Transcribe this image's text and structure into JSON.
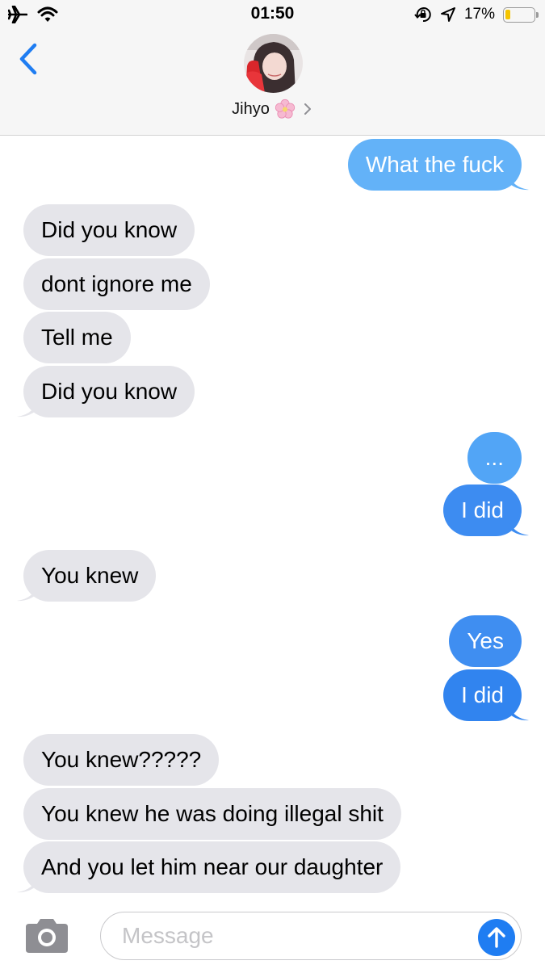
{
  "status_bar": {
    "time": "01:50",
    "battery_percent": "17%",
    "battery_level": 0.17,
    "icons": [
      "airplane-icon",
      "wifi-icon",
      "rotation-lock-icon",
      "location-icon",
      "battery-icon"
    ]
  },
  "header": {
    "contact_name": "Jihyo",
    "contact_emoji": "cherry-blossom-icon"
  },
  "messages": [
    {
      "sender": "me",
      "text": "What the fuck"
    },
    {
      "sender": "them",
      "text": "Did you know"
    },
    {
      "sender": "them",
      "text": "dont ignore me"
    },
    {
      "sender": "them",
      "text": "Tell me"
    },
    {
      "sender": "them",
      "text": "Did you know"
    },
    {
      "sender": "me",
      "text": "..."
    },
    {
      "sender": "me",
      "text": "I did"
    },
    {
      "sender": "them",
      "text": "You knew"
    },
    {
      "sender": "me",
      "text": "Yes"
    },
    {
      "sender": "me",
      "text": "I did"
    },
    {
      "sender": "them",
      "text": "You knew?????"
    },
    {
      "sender": "them",
      "text": "You knew he was doing illegal shit"
    },
    {
      "sender": "them",
      "text": "And you let him near our daughter"
    }
  ],
  "input": {
    "placeholder": "Message",
    "value": ""
  },
  "colors": {
    "outgoing_bubble_top": "#64b3f8",
    "outgoing_bubble_bottom": "#2f82ee",
    "incoming_bubble": "#e5e5ea",
    "accent": "#1f7df2"
  }
}
